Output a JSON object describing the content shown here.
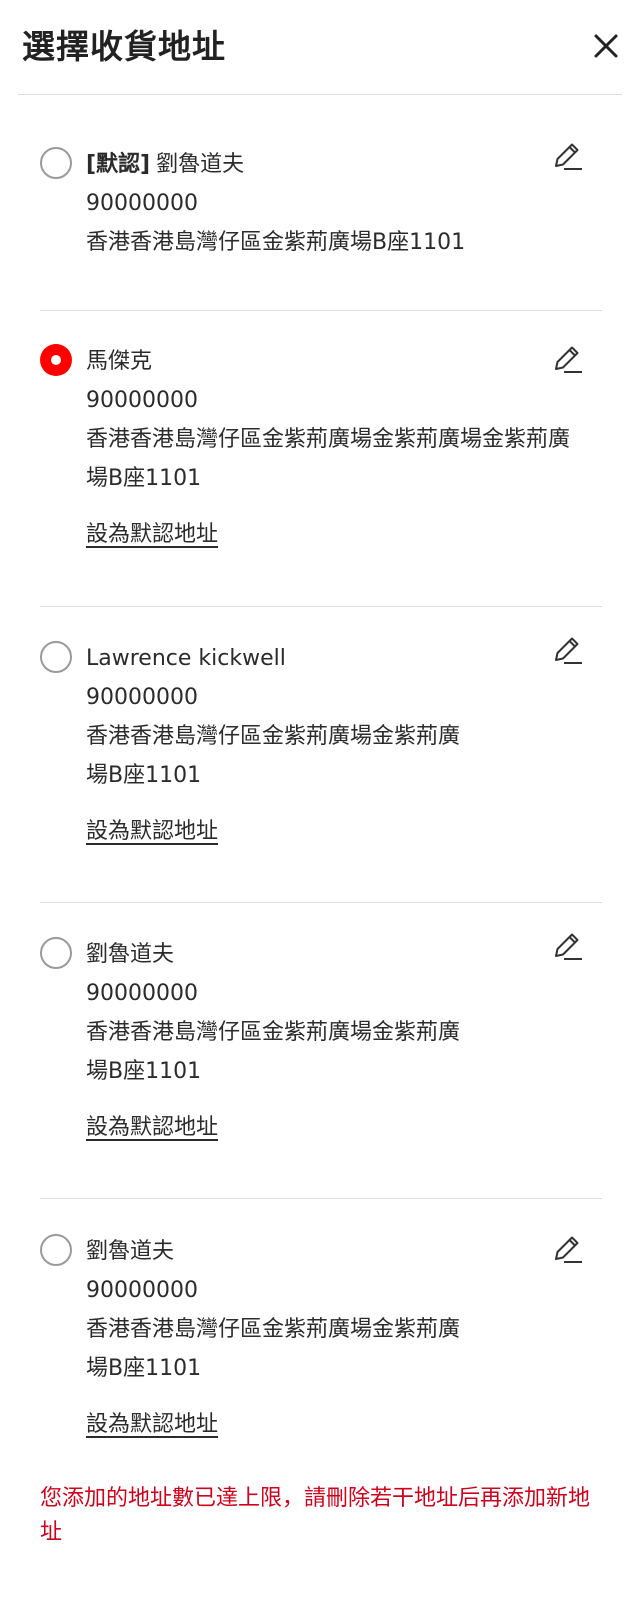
{
  "header": {
    "title": "選擇收貨地址",
    "close_icon": "close-icon"
  },
  "addresses": [
    {
      "selected": false,
      "default_tag": "[默認]",
      "name": "劉魯道夫",
      "phone": "90000000",
      "address": "香港香港島灣仔區金紫荊廣場B座1101",
      "set_default_label": ""
    },
    {
      "selected": true,
      "default_tag": "",
      "name": "馬傑克",
      "phone": "90000000",
      "address": "香港香港島灣仔區金紫荊廣場金紫荊廣場金紫荊廣場B座1101",
      "set_default_label": "設為默認地址"
    },
    {
      "selected": false,
      "default_tag": "",
      "name": "Lawrence kickwell",
      "phone": "90000000",
      "address": "香港香港島灣仔區金紫荊廣場金紫荊廣場B座1101",
      "set_default_label": "設為默認地址"
    },
    {
      "selected": false,
      "default_tag": "",
      "name": "劉魯道夫",
      "phone": "90000000",
      "address": "香港香港島灣仔區金紫荊廣場金紫荊廣場B座1101",
      "set_default_label": "設為默認地址"
    },
    {
      "selected": false,
      "default_tag": "",
      "name": "劉魯道夫",
      "phone": "90000000",
      "address": "香港香港島灣仔區金紫荊廣場金紫荊廣場B座1101",
      "set_default_label": "設為默認地址"
    }
  ],
  "limit_message": "您添加的地址數已達上限，請刪除若干地址后再添加新地址",
  "colors": {
    "accent": "#ff0000",
    "error_text": "#d0021b",
    "divider": "#dcdcdc"
  }
}
